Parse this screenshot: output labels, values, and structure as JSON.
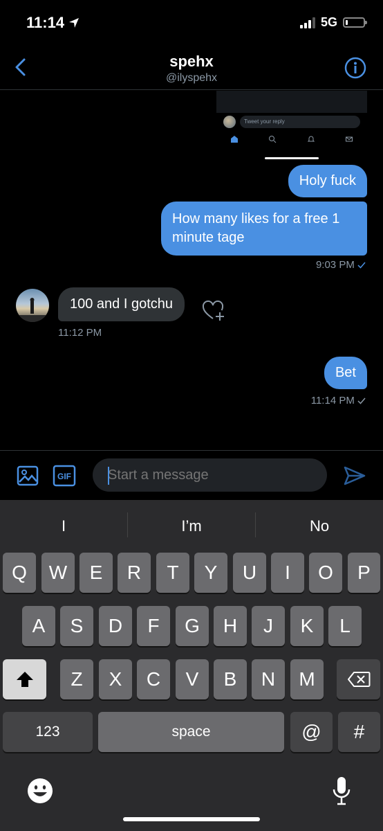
{
  "status_bar": {
    "time": "11:14",
    "network": "5G"
  },
  "header": {
    "name": "spehx",
    "handle": "@ilyspehx"
  },
  "embedded_image": {
    "reply_placeholder": "Tweet your reply"
  },
  "messages": [
    {
      "text": "Holy fuck",
      "direction": "outgoing"
    },
    {
      "text": "How many likes for a free 1 minute tage",
      "direction": "outgoing",
      "timestamp": "9:03 PM"
    },
    {
      "text": "100 and I gotchu",
      "direction": "incoming",
      "timestamp": "11:12 PM"
    },
    {
      "text": "Bet",
      "direction": "outgoing",
      "timestamp": "11:14 PM"
    }
  ],
  "compose": {
    "placeholder": "Start a message",
    "gif_label": "GIF"
  },
  "keyboard": {
    "suggestions": [
      "I",
      "I’m",
      "No"
    ],
    "row1": [
      "Q",
      "W",
      "E",
      "R",
      "T",
      "Y",
      "U",
      "I",
      "O",
      "P"
    ],
    "row2": [
      "A",
      "S",
      "D",
      "F",
      "G",
      "H",
      "J",
      "K",
      "L"
    ],
    "row3": [
      "Z",
      "X",
      "C",
      "V",
      "B",
      "N",
      "M"
    ],
    "numbers_label": "123",
    "space_label": "space",
    "at_label": "@",
    "hash_label": "#"
  },
  "colors": {
    "accent": "#4a90e2",
    "incoming_bubble": "#2f3336",
    "background": "#000000"
  }
}
